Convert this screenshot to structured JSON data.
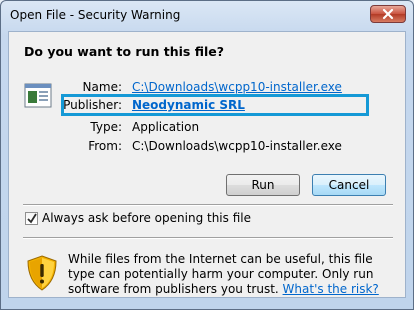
{
  "window": {
    "title": "Open File - Security Warning"
  },
  "dialog": {
    "question": "Do you want to run this file?",
    "fields": {
      "name_label": "Name:",
      "name_value": "C:\\Downloads\\wcpp10-installer.exe",
      "publisher_label": "Publisher:",
      "publisher_value": "Neodynamic SRL",
      "type_label": "Type:",
      "type_value": "Application",
      "from_label": "From:",
      "from_value": "C:\\Downloads\\wcpp10-installer.exe"
    },
    "buttons": {
      "run": "Run",
      "cancel": "Cancel"
    },
    "checkbox": {
      "label": "Always ask before opening this file",
      "checked": true
    },
    "warning": {
      "text": "While files from the Internet can be useful, this file type can potentially harm your computer. Only run software from publishers you trust.",
      "link": "What's the risk?"
    }
  },
  "colors": {
    "link": "#0066cc",
    "highlight_border": "#1599d6",
    "close_button": "#c9523f"
  },
  "icons": {
    "file": "application-file-icon",
    "shield": "security-shield-warning-icon",
    "close": "close-icon",
    "check": "checkmark-icon"
  }
}
